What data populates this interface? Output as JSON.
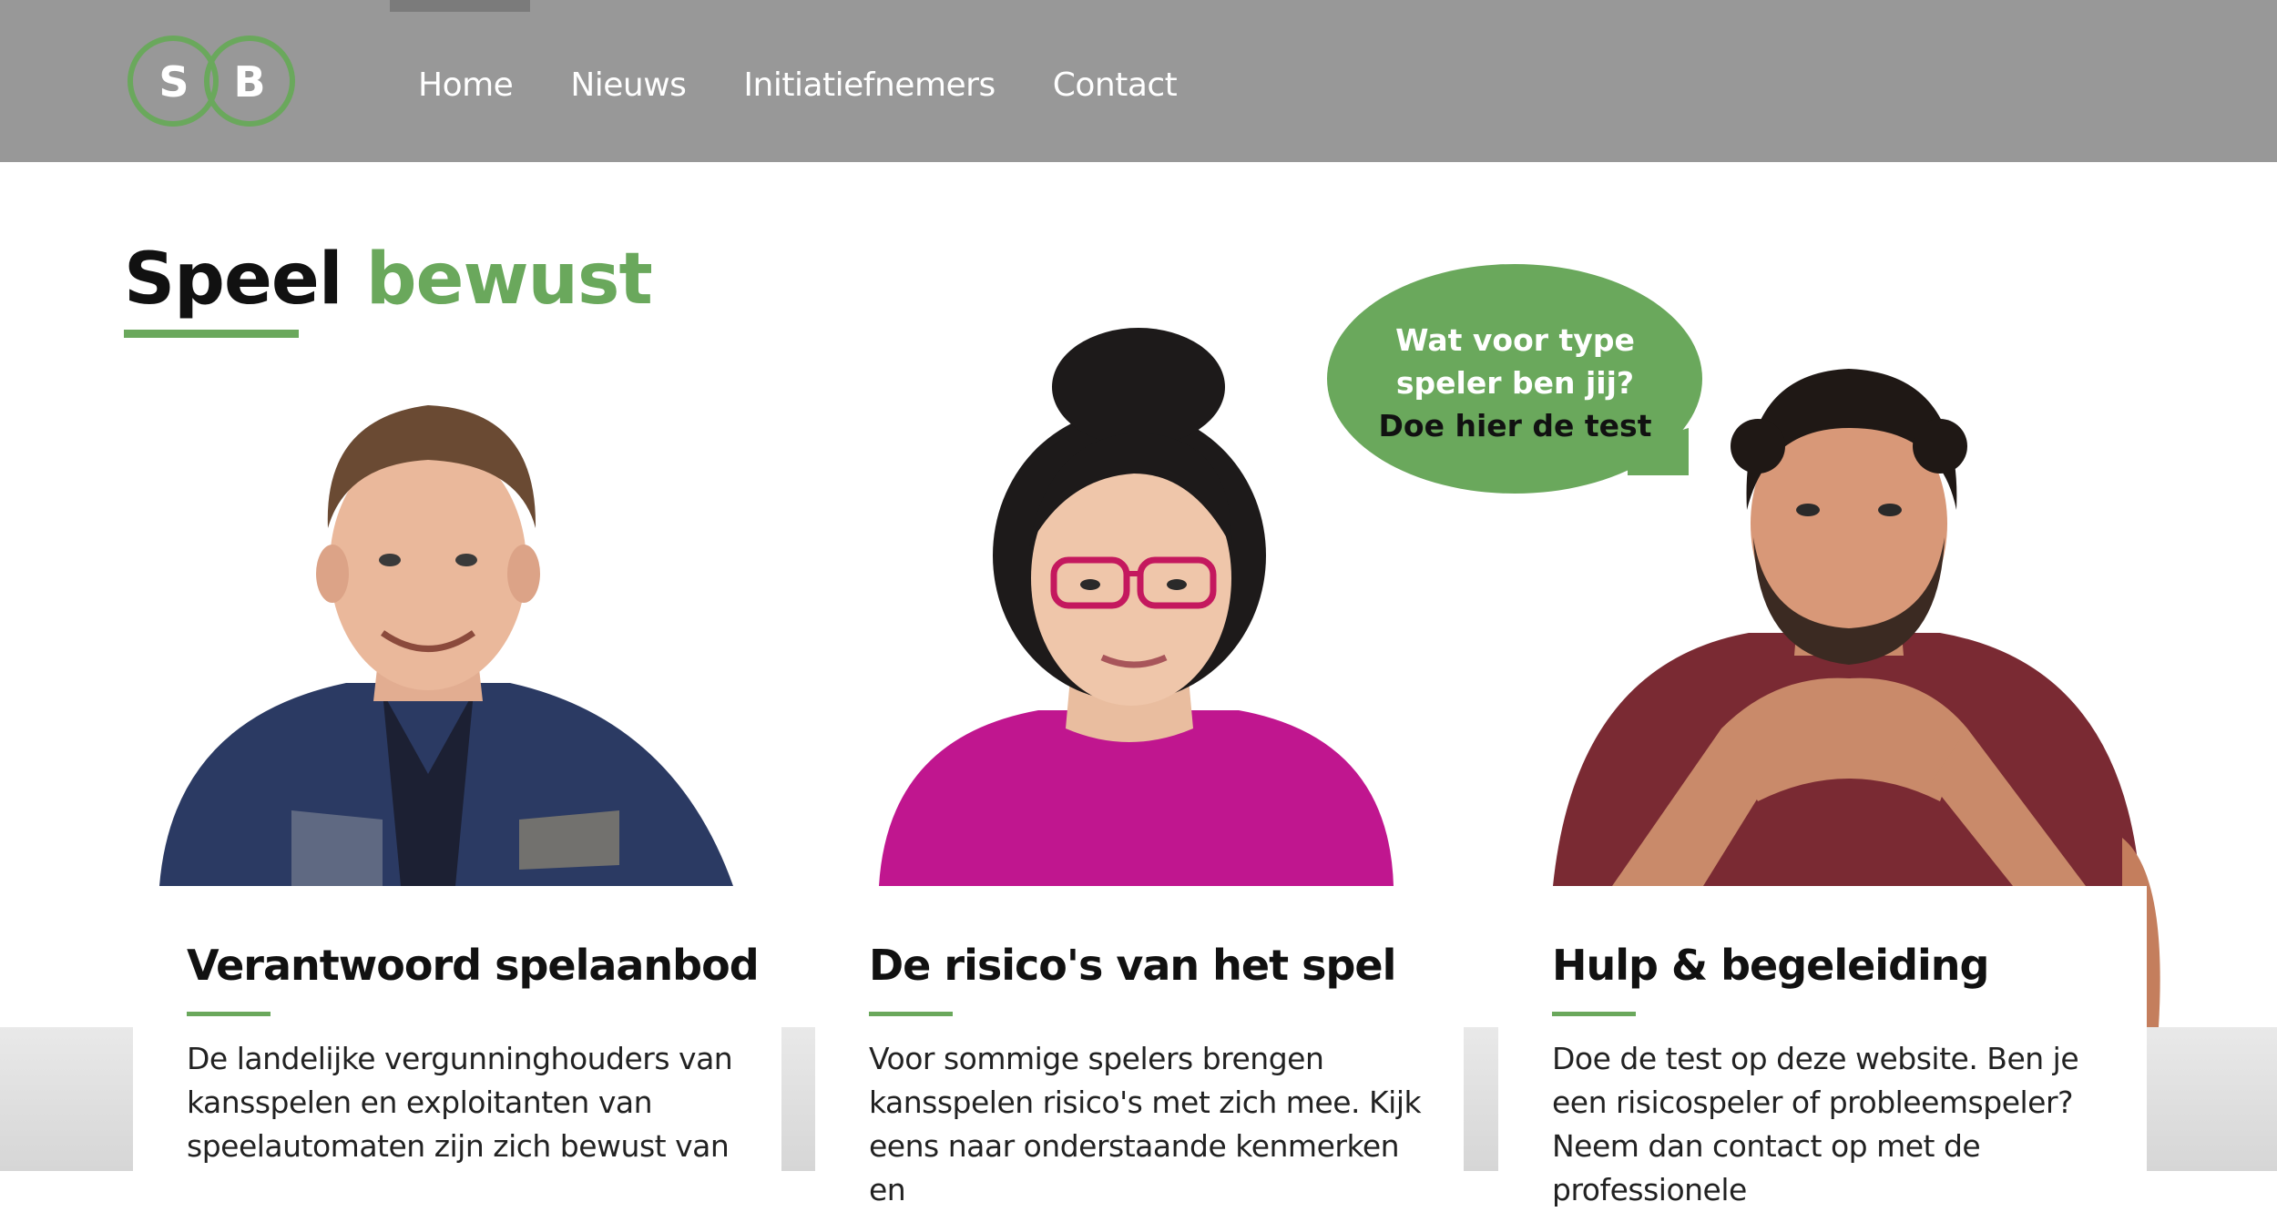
{
  "header": {
    "logo_letters": [
      "S",
      "B"
    ],
    "nav": [
      "Home",
      "Nieuws",
      "Initiatiefnemers",
      "Contact"
    ]
  },
  "page_title": {
    "part1": "Speel",
    "part2": "bewust"
  },
  "bubble": {
    "question_line1": "Wat voor type",
    "question_line2": "speler ben jij?",
    "cta": "Doe hier de test"
  },
  "cards": [
    {
      "title": "Verantwoord spelaanbod",
      "text": "De landelijke vergunninghouders van kansspelen en exploitanten van speelautomaten zijn zich bewust van"
    },
    {
      "title": "De risico's van het spel",
      "text": "Voor sommige spelers brengen kansspelen risico's met zich mee. Kijk eens naar onderstaande kenmerken en"
    },
    {
      "title": "Hulp & begeleiding",
      "text": "Doe de test op deze website. Ben je een risicospeler of probleemspeler? Neem dan contact op met de professionele"
    }
  ],
  "colors": {
    "header_bg": "#989898",
    "accent_green": "#6aa85c",
    "text_dark": "#111111",
    "white": "#ffffff"
  }
}
